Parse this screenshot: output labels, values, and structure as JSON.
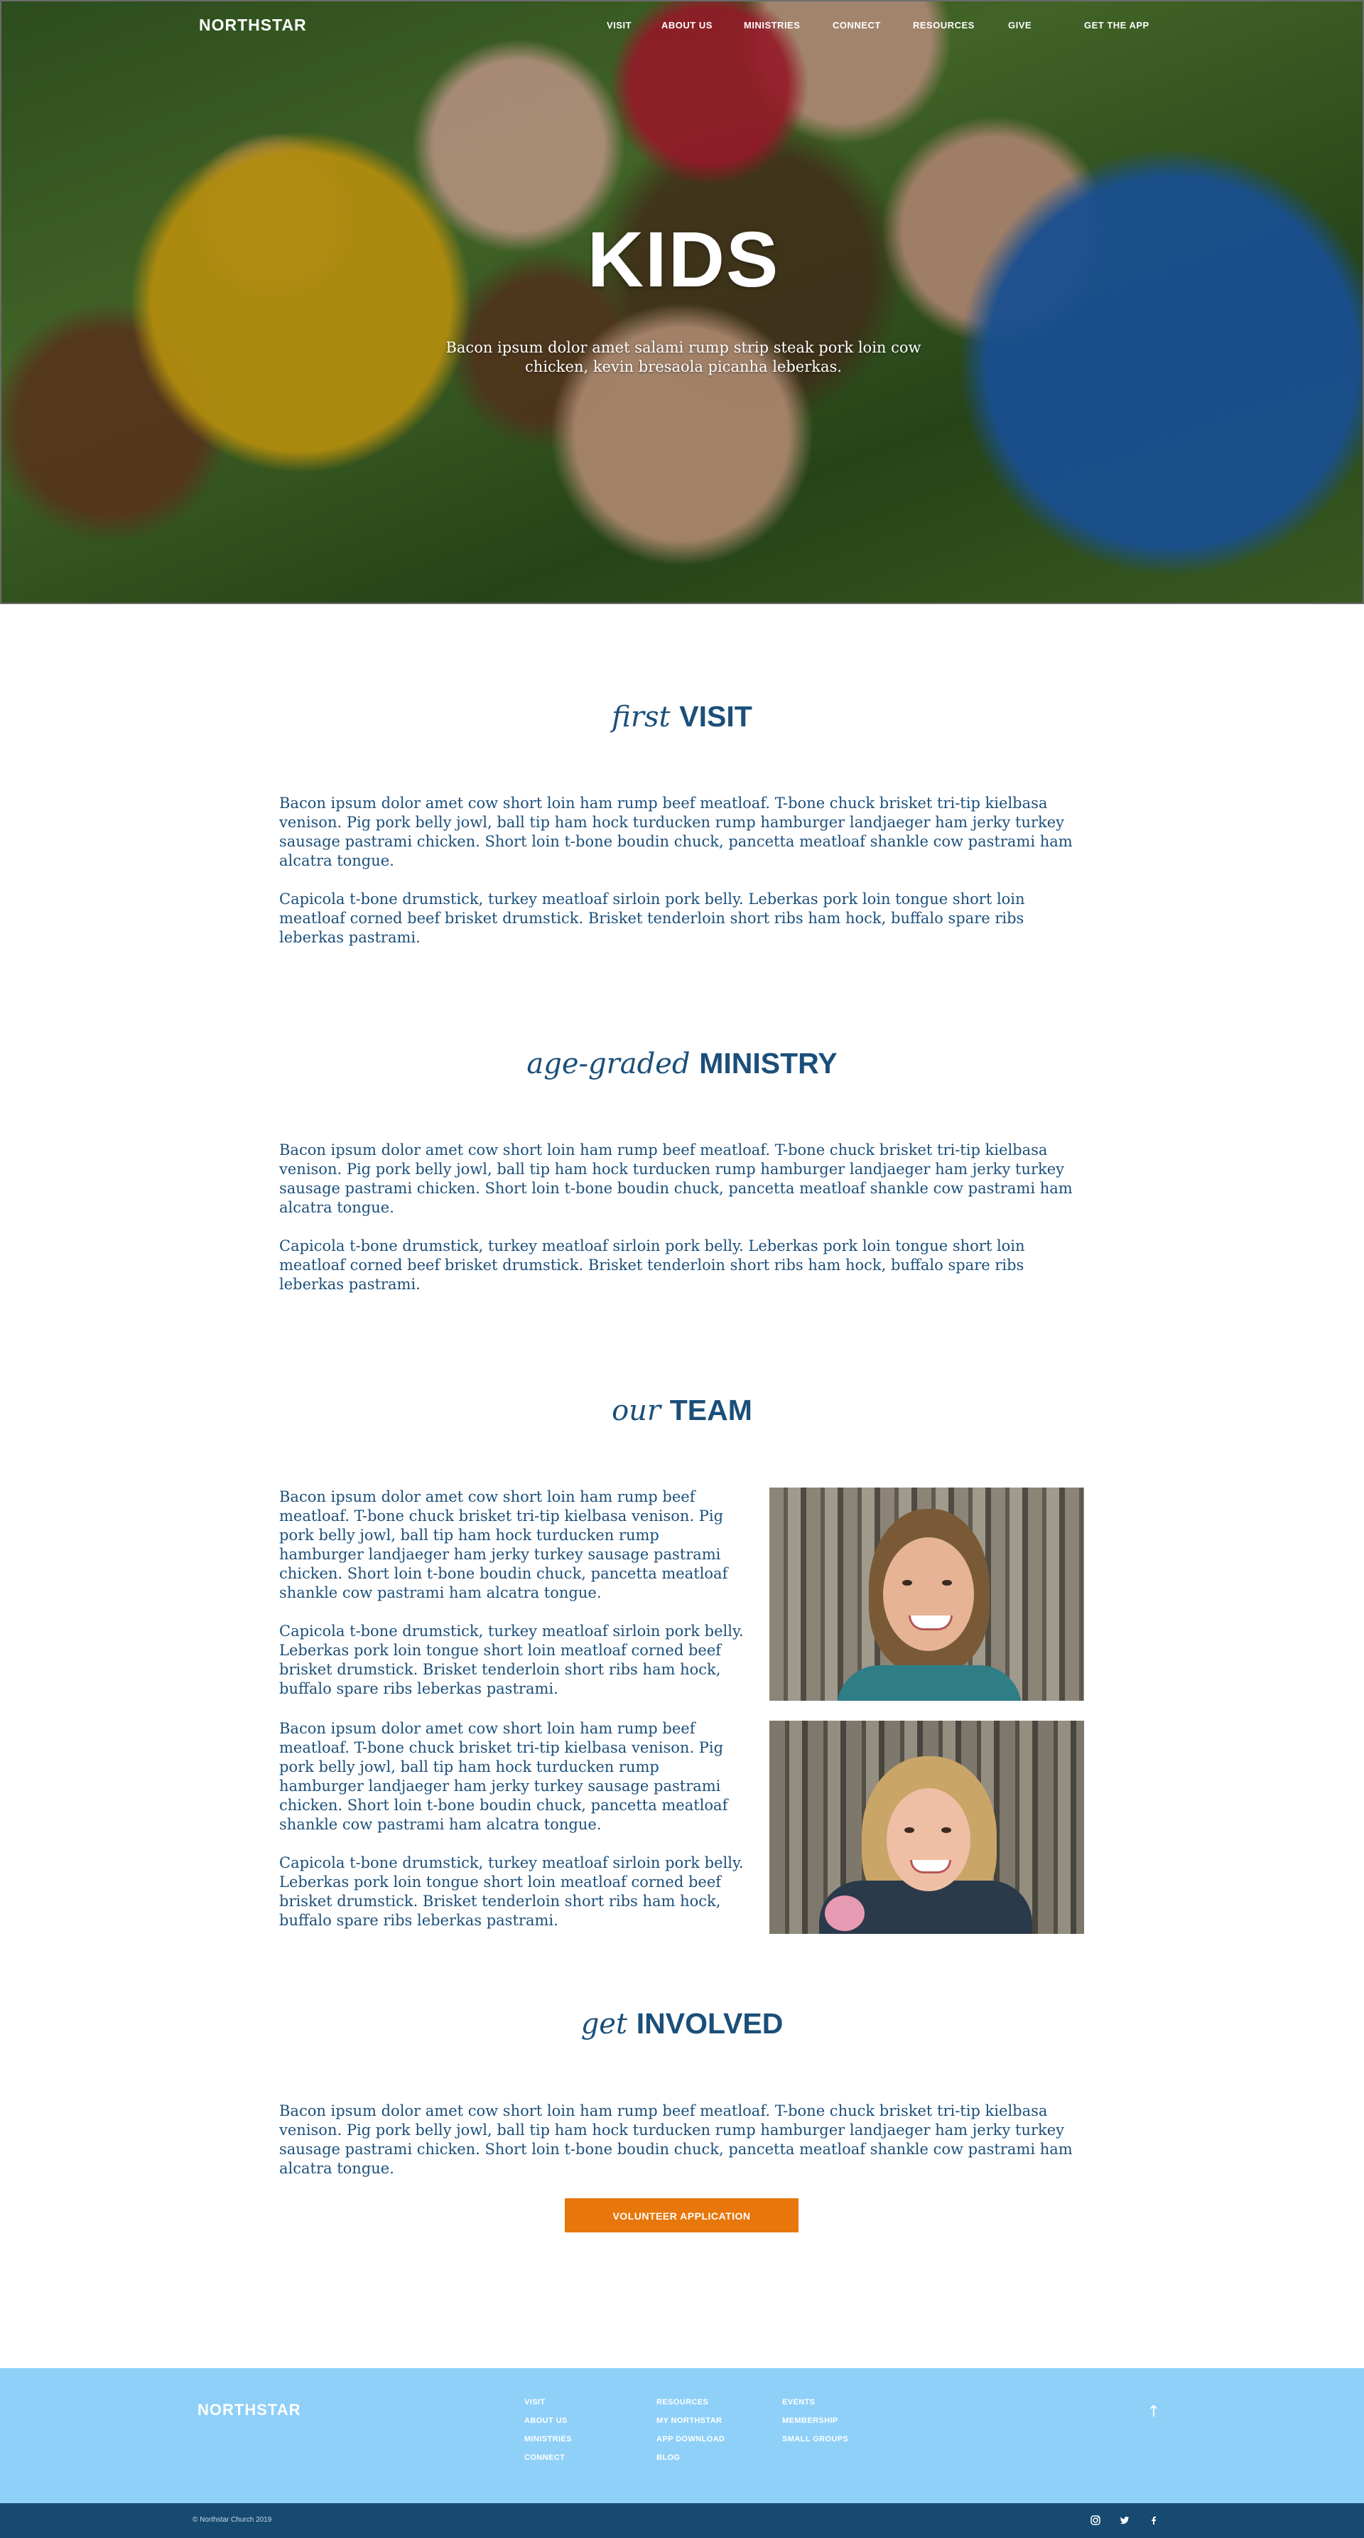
{
  "nav": {
    "logo": "NORTHSTAR",
    "items": [
      "VISIT",
      "ABOUT US",
      "MINISTRIES",
      "CONNECT",
      "RESOURCES",
      "GIVE"
    ],
    "cta": "GET THE APP"
  },
  "hero": {
    "title": "KIDS",
    "subtitle": "Bacon ipsum dolor amet salami rump strip steak pork loin cow chicken, kevin bresaola picanha leberkas."
  },
  "sections": [
    {
      "italic": "first",
      "bold": "VISIT",
      "paragraphs": [
        "Bacon ipsum dolor amet cow short loin ham rump beef meatloaf. T-bone chuck brisket tri-tip kielbasa venison. Pig pork belly jowl, ball tip ham hock turducken rump hamburger landjaeger ham jerky turkey sausage pastrami chicken. Short loin t-bone boudin chuck, pancetta meatloaf shankle cow pastrami ham alcatra tongue.",
        "Capicola t-bone drumstick, turkey meatloaf sirloin pork belly. Leberkas pork loin tongue short loin meatloaf corned beef brisket drumstick. Brisket tenderloin short ribs ham hock, buffalo spare ribs leberkas pastrami."
      ]
    },
    {
      "italic": "age-graded",
      "bold": "MINISTRY",
      "paragraphs": [
        "Bacon ipsum dolor amet cow short loin ham rump beef meatloaf. T-bone chuck brisket tri-tip kielbasa venison. Pig pork belly jowl, ball tip ham hock turducken rump hamburger landjaeger ham jerky turkey sausage pastrami chicken. Short loin t-bone boudin chuck, pancetta meatloaf shankle cow pastrami ham alcatra tongue.",
        "Capicola t-bone drumstick, turkey meatloaf sirloin pork belly. Leberkas pork loin tongue short loin meatloaf corned beef brisket drumstick. Brisket tenderloin short ribs ham hock, buffalo spare ribs leberkas pastrami."
      ]
    },
    {
      "italic": "our",
      "bold": "TEAM",
      "members": [
        {
          "paragraphs": [
            "Bacon ipsum dolor amet cow short loin ham rump beef meatloaf. T-bone chuck brisket tri-tip kielbasa venison. Pig pork belly jowl, ball tip ham hock turducken rump hamburger landjaeger ham jerky turkey sausage pastrami chicken. Short loin t-bone boudin chuck, pancetta meatloaf shankle cow pastrami ham alcatra tongue.",
            "Capicola t-bone drumstick, turkey meatloaf sirloin pork belly. Leberkas pork loin tongue short loin meatloaf corned beef brisket drumstick. Brisket tenderloin short ribs ham hock, buffalo spare ribs leberkas pastrami."
          ]
        },
        {
          "paragraphs": [
            "Bacon ipsum dolor amet cow short loin ham rump beef meatloaf. T-bone chuck brisket tri-tip kielbasa venison. Pig pork belly jowl, ball tip ham hock turducken rump hamburger landjaeger ham jerky turkey sausage pastrami chicken. Short loin t-bone boudin chuck, pancetta meatloaf shankle cow pastrami ham alcatra tongue.",
            "Capicola t-bone drumstick, turkey meatloaf sirloin pork belly. Leberkas pork loin tongue short loin meatloaf corned beef brisket drumstick. Brisket tenderloin short ribs ham hock, buffalo spare ribs leberkas pastrami."
          ]
        }
      ]
    },
    {
      "italic": "get",
      "bold": "INVOLVED",
      "paragraphs": [
        "Bacon ipsum dolor amet cow short loin ham rump beef meatloaf. T-bone chuck brisket tri-tip kielbasa venison. Pig pork belly jowl, ball tip ham hock turducken rump hamburger landjaeger ham jerky turkey sausage pastrami chicken. Short loin t-bone boudin chuck, pancetta meatloaf shankle cow pastrami ham alcatra tongue."
      ],
      "button": "VOLUNTEER APPLICATION"
    }
  ],
  "footer": {
    "logo": "NORTHSTAR",
    "columns": [
      [
        "VISIT",
        "ABOUT US",
        "MINISTRIES",
        "CONNECT"
      ],
      [
        "RESOURCES",
        "MY NORTHSTAR",
        "APP DOWNLOAD",
        "BLOG"
      ],
      [
        "EVENTS",
        "MEMBERSHIP",
        "SMALL GROUPS"
      ]
    ],
    "back_to_top_icon": "arrow-up-icon",
    "copyright": "© Northstar Church 2019",
    "social_icons": [
      "instagram-icon",
      "twitter-icon",
      "facebook-icon"
    ]
  },
  "colors": {
    "primary_text": "#1b4f7a",
    "button": "#e7770b",
    "footer_bg": "#8fd0f9",
    "bottom_bar": "#174a71"
  }
}
